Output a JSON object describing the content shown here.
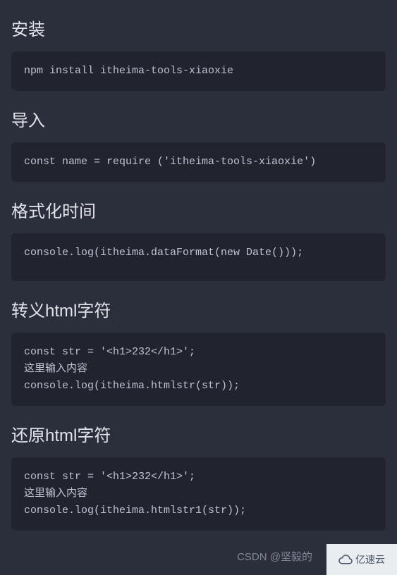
{
  "sections": [
    {
      "heading": "安装",
      "code": "npm install itheima-tools-xiaoxie",
      "blockClass": ""
    },
    {
      "heading": "导入",
      "code": "const name = require ('itheima-tools-xiaoxie')",
      "blockClass": ""
    },
    {
      "heading": "格式化时间",
      "code": "console.log(itheima.dataFormat(new Date()));",
      "blockClass": "medium"
    },
    {
      "heading": "转义html字符",
      "code": "const str = '<h1>232</h1>';\n这里输入内容\nconsole.log(itheima.htmlstr(str));",
      "blockClass": ""
    },
    {
      "heading": "还原html字符",
      "code": "const str = '<h1>232</h1>';\n这里输入内容\nconsole.log(itheima.htmlstr1(str));",
      "blockClass": ""
    }
  ],
  "watermark_csdn": "CSDN @坚毅的",
  "watermark_yisu": "亿速云"
}
